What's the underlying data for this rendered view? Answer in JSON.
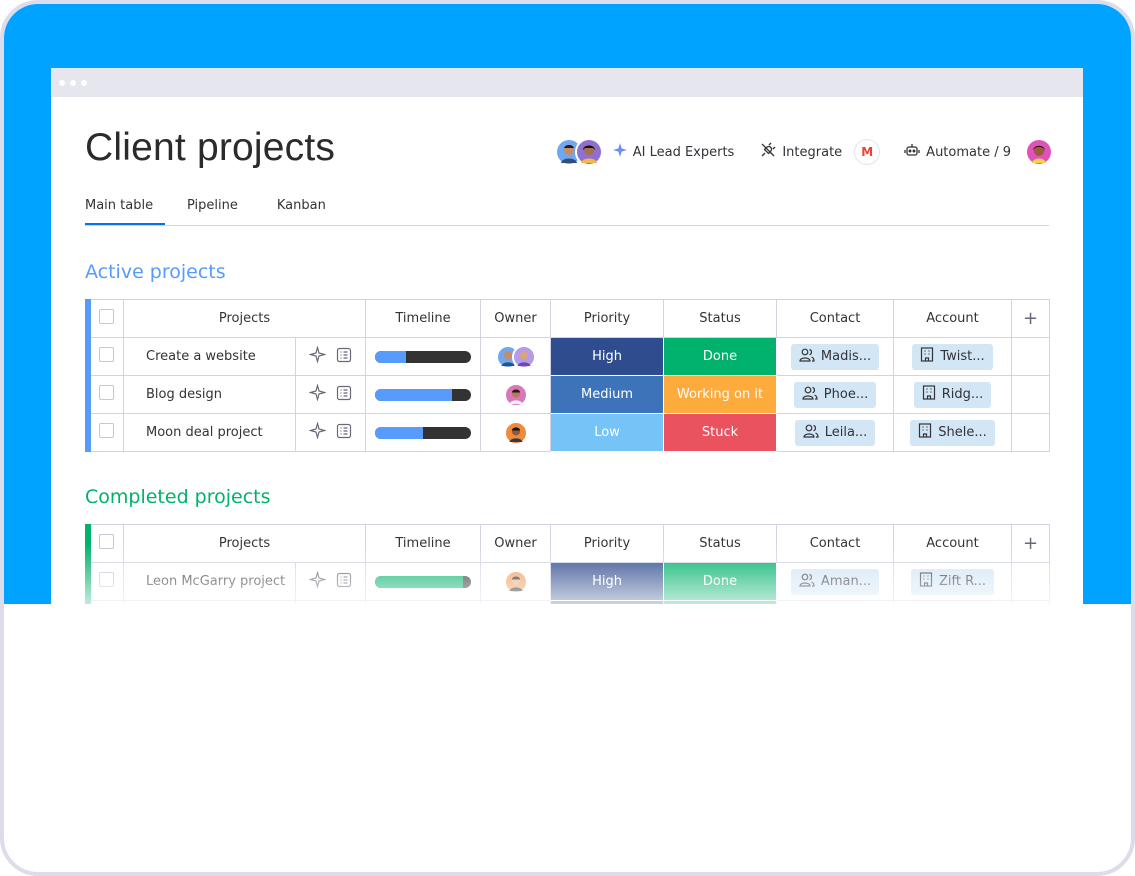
{
  "page": {
    "title": "Client projects"
  },
  "header": {
    "ai_label": "AI Lead Experts",
    "integrate_label": "Integrate",
    "gmail_letter": "M",
    "automate_label": "Automate / 9"
  },
  "tabs": [
    {
      "label": "Main table",
      "active": true
    },
    {
      "label": "Pipeline",
      "active": false
    },
    {
      "label": "Kanban",
      "active": false
    }
  ],
  "columns": {
    "projects": "Projects",
    "timeline": "Timeline",
    "owner": "Owner",
    "priority": "Priority",
    "status": "Status",
    "contact": "Contact",
    "account": "Account",
    "add": "+"
  },
  "groups": [
    {
      "title": "Active projects",
      "color": "#579bfc",
      "rows": [
        {
          "name": "Create a website",
          "timeline_progress": 0.32,
          "timeline_color": "#579bfc",
          "priority": "High",
          "priority_color": "#2f4d8e",
          "status": "Done",
          "status_color": "#00b26b",
          "contact": "Madis...",
          "account": "Twist..."
        },
        {
          "name": "Blog design",
          "timeline_progress": 0.8,
          "timeline_color": "#579bfc",
          "priority": "Medium",
          "priority_color": "#3d74b9",
          "status": "Working on it",
          "status_color": "#fdab3d",
          "contact": "Phoe...",
          "account": "Ridg..."
        },
        {
          "name": "Moon deal project",
          "timeline_progress": 0.5,
          "timeline_color": "#579bfc",
          "priority": "Low",
          "priority_color": "#76c3f7",
          "status": "Stuck",
          "status_color": "#e9525e",
          "contact": "Leila...",
          "account": "Shele..."
        }
      ]
    },
    {
      "title": "Completed projects",
      "color": "#00b26b",
      "rows": [
        {
          "name": "Leon McGarry project",
          "timeline_progress": 0.92,
          "timeline_color": "#00b26b",
          "priority": "High",
          "priority_color": "#2f4d8e",
          "status": "Done",
          "status_color": "#00b26b",
          "contact": "Aman...",
          "account": "Zift R..."
        }
      ]
    }
  ],
  "icons": [
    "sparkle-icon",
    "plug-icon",
    "robot-icon",
    "gmail-icon",
    "ai-sparkle-icon",
    "notes-icon",
    "people-icon",
    "building-icon"
  ]
}
